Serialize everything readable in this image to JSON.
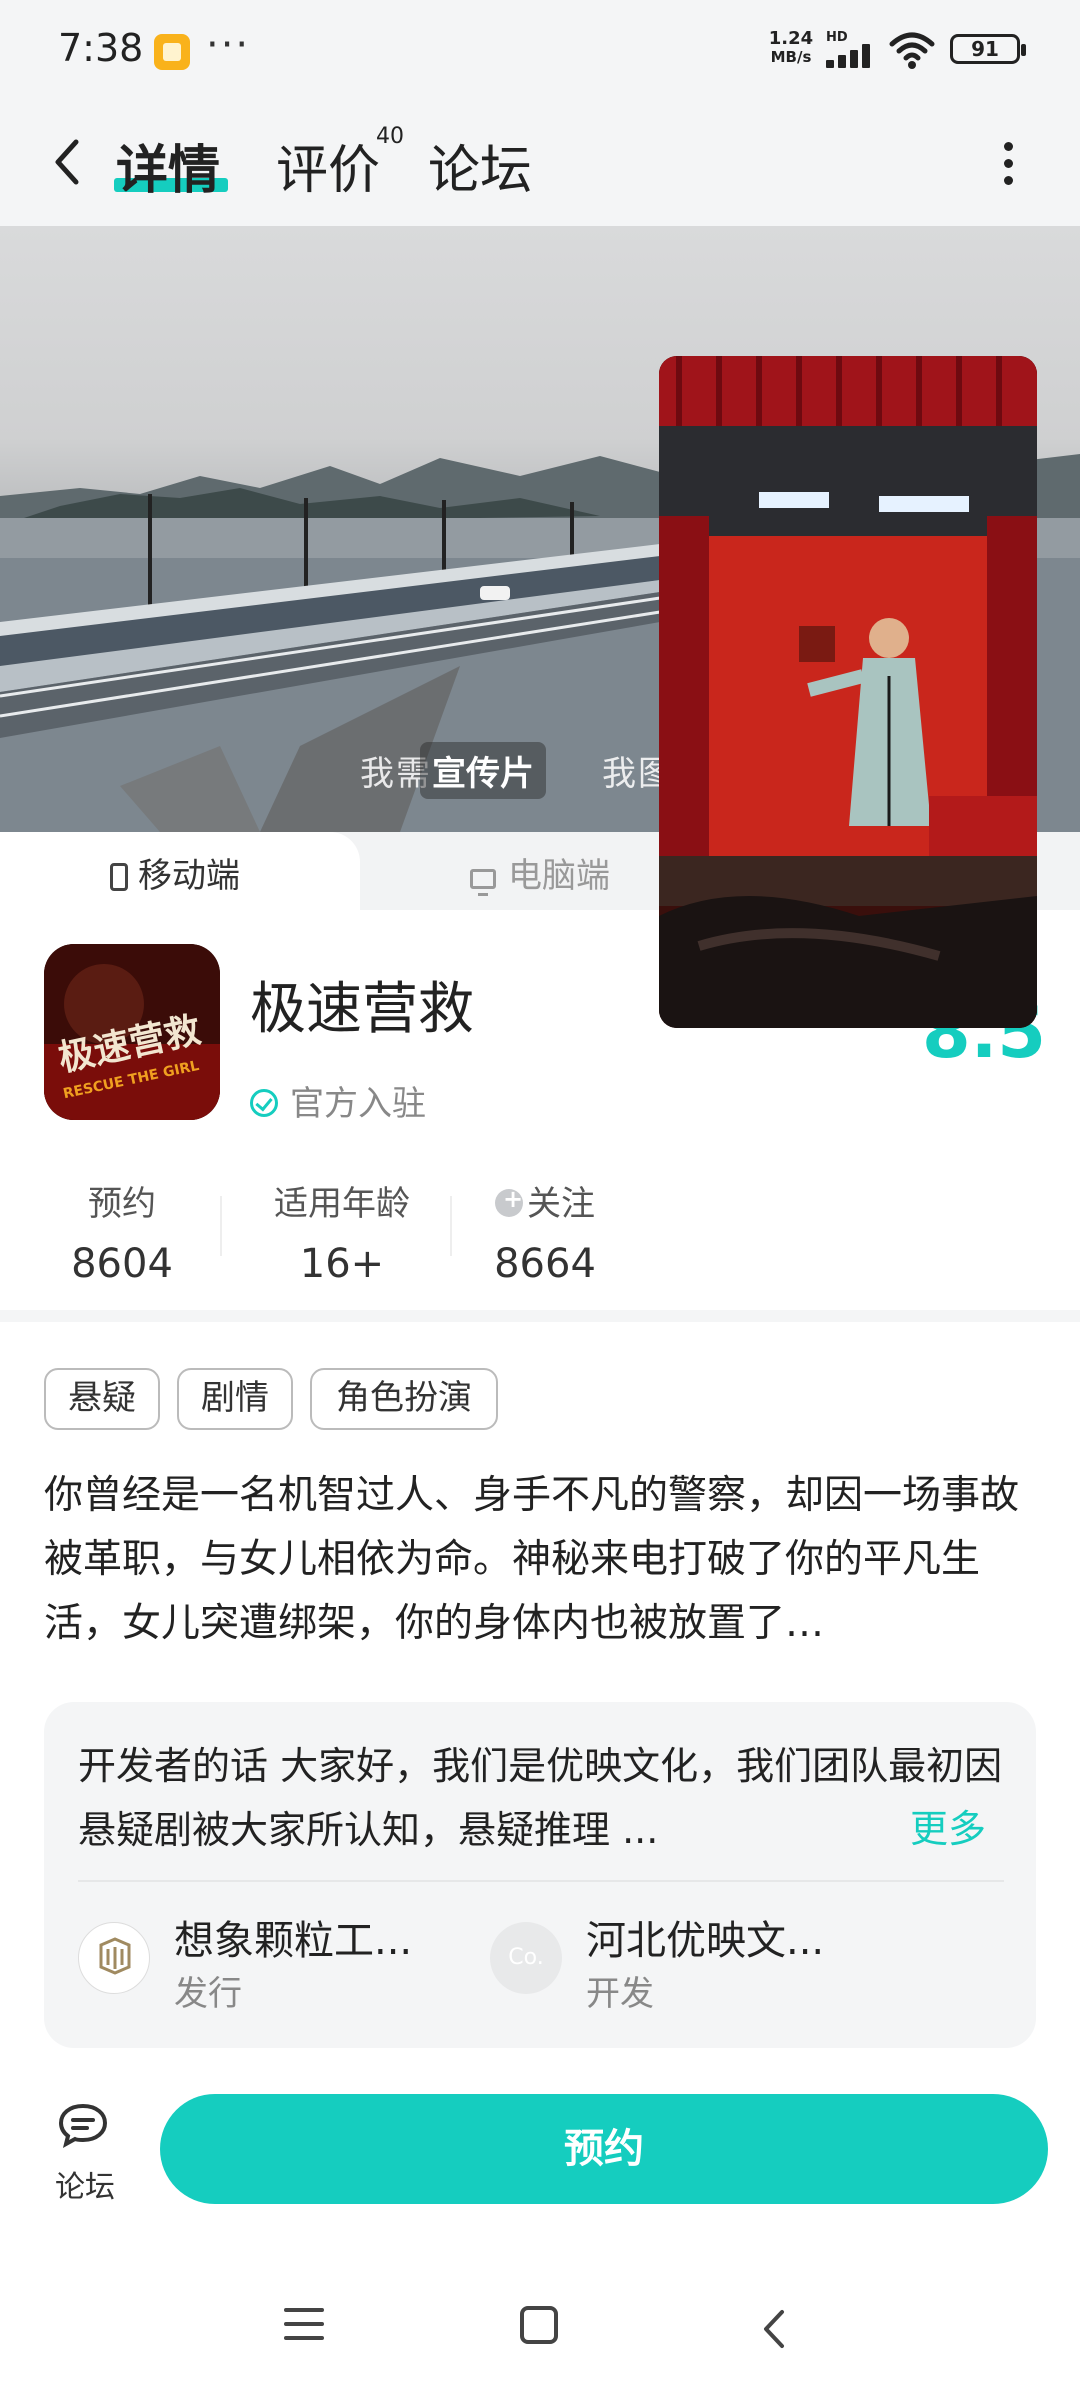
{
  "status": {
    "time": "7:38",
    "more": "···",
    "speed_value": "1.24",
    "speed_unit": "MB/s",
    "network": "HD",
    "battery": "91"
  },
  "nav": {
    "tabs": [
      {
        "label": "详情"
      },
      {
        "label": "评价",
        "badge": "40"
      },
      {
        "label": "论坛"
      }
    ]
  },
  "hero": {
    "caption_left": "我需",
    "caption_right": "我图集",
    "badge": "宣传片"
  },
  "platform": {
    "mobile": "移动端",
    "pc": "电脑端"
  },
  "game": {
    "title": "极速营救",
    "official": "官方入驻",
    "score": "8.5",
    "icon_text": "极速营救",
    "icon_subtext": "RESCUE THE GIRL"
  },
  "stats": [
    {
      "label": "预约",
      "value": "8604"
    },
    {
      "label": "适用年龄",
      "value": "16+"
    },
    {
      "label": "关注",
      "value": "8664"
    }
  ],
  "tags": [
    "悬疑",
    "剧情",
    "角色扮演"
  ],
  "description": "你曾经是一名机智过人、身手不凡的警察，却因一场事故被革职，与女儿相依为命。神秘来电打破了你的平凡生活，女儿突遭绑架，你的身体内也被放置了…",
  "developer": {
    "words": "开发者的话  大家好，我们是优映文化，我们团队最初因悬疑剧被大家所认知，悬疑推理 ...",
    "more": "更多",
    "publisher": {
      "name": "想象颗粒工...",
      "role": "发行"
    },
    "dev": {
      "name": "河北优映文...",
      "role": "开发",
      "logo_text": "Co."
    }
  },
  "bottom": {
    "forum": "论坛",
    "reserve": "预约"
  },
  "colors": {
    "accent": "#15cdbf"
  }
}
